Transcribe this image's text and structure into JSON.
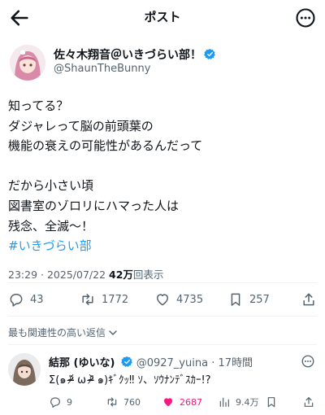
{
  "header": {
    "title": "ポスト"
  },
  "author": {
    "name": "佐々木翔音＠いきづらい部！",
    "handle": "@ShaunTheBunny"
  },
  "tweet": {
    "lines": [
      "知ってる？",
      "ダジャレって脳の前頭葉の",
      "機能の衰えの可能性があるんだって",
      "",
      "だから小さい頃",
      "図書室のゾロリにハマった人は",
      "残念、全滅〜！"
    ],
    "hashtag": "#いきづらい部"
  },
  "meta": {
    "time": "23:29",
    "separator": "·",
    "date": "2025/07/22",
    "views": "42万",
    "views_label": "回表示"
  },
  "actions": {
    "replies": "43",
    "reposts": "1772",
    "likes": "4735",
    "bookmarks": "257"
  },
  "sort_label": "最も関連性の高い返信",
  "reply": {
    "name": "結那 (ゆいな)",
    "handle": "@0927_yuina",
    "time": "· 17時間",
    "text": "Σ(๑ ᵒ̴̶̷᷄ ω ᵒ̴̶̷᷅ ๑)ｷﾞｸｯ‼ ｿ、ｿｳﾅﾝﾃﾞｽｶｰ!?",
    "replies": "9",
    "reposts": "760",
    "likes": "2687",
    "views": "9.4万"
  },
  "colors": {
    "accent": "#1d9bf0",
    "like": "#f91880",
    "muted": "#536471"
  }
}
